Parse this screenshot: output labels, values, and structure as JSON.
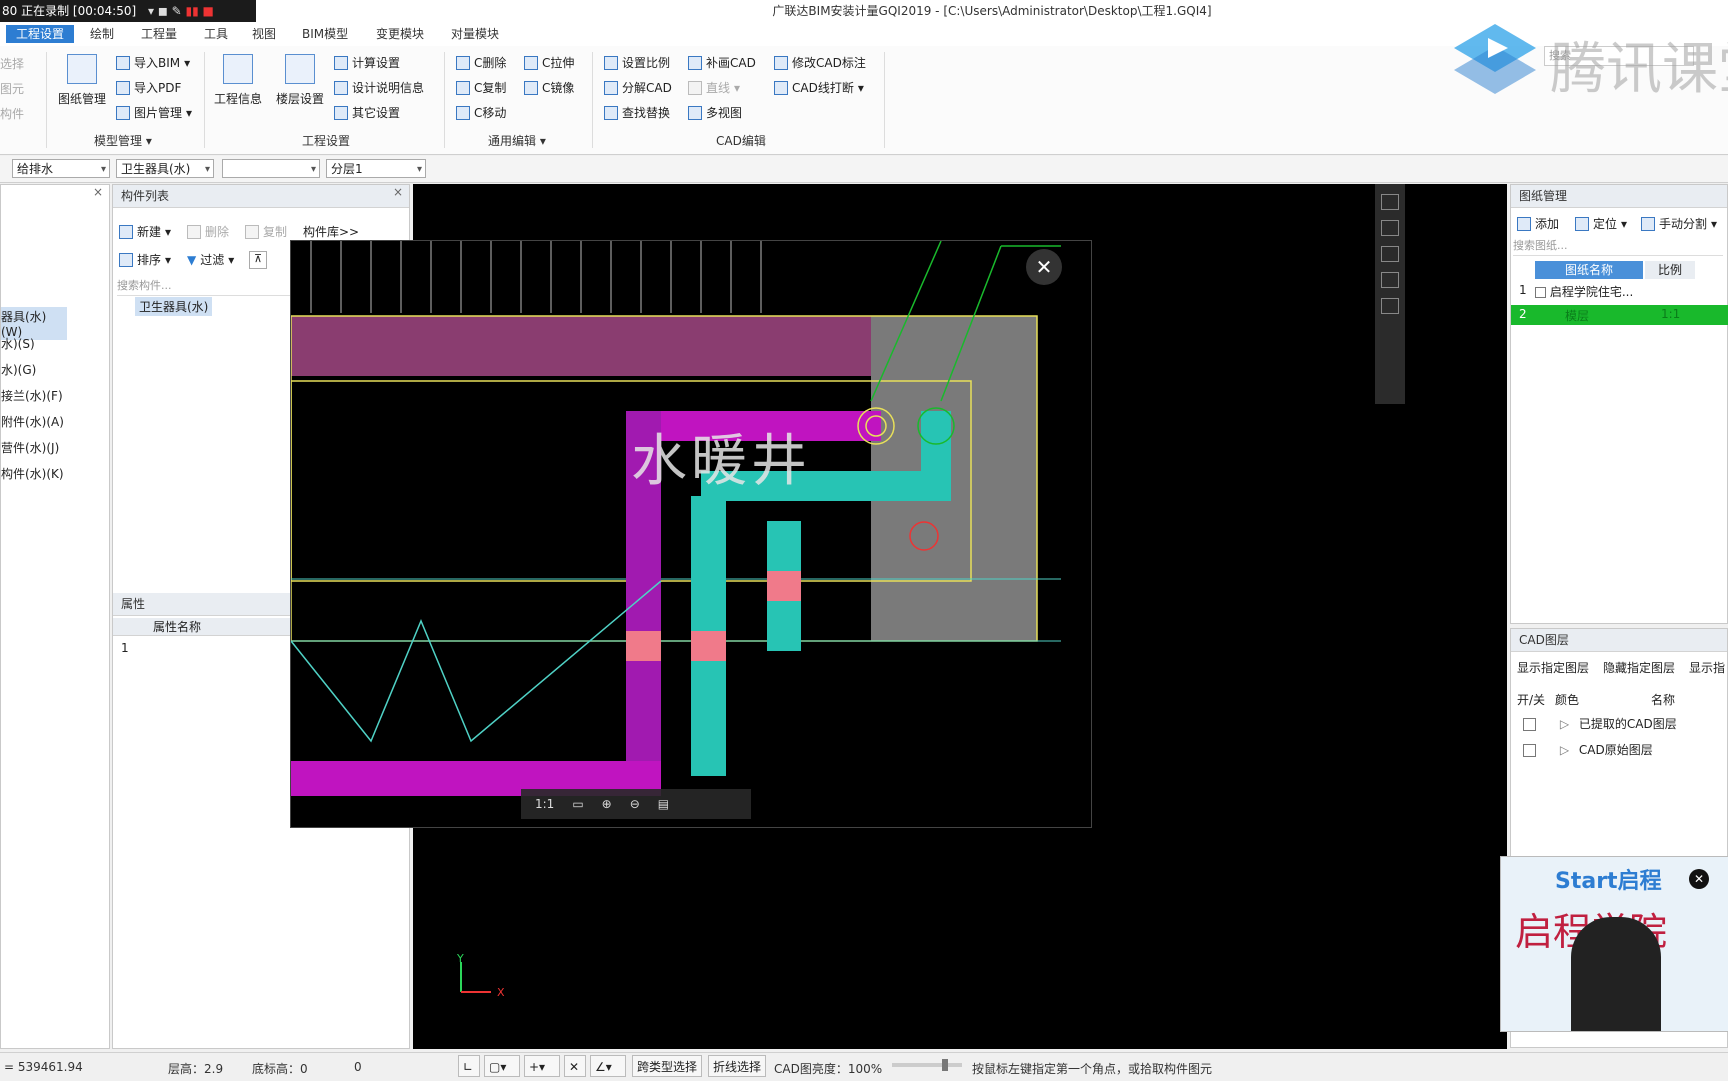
{
  "recording": {
    "text": "80 正在录制 [00:04:50]"
  },
  "window": {
    "title": "广联达BIM安装计量GQI2019 - [C:\\Users\\Administrator\\Desktop\\工程1.GQI4]"
  },
  "menus": [
    "工程设置",
    "绘制",
    "工程量",
    "工具",
    "视图",
    "BIM模型",
    "变更模块",
    "对量模块"
  ],
  "ribbon": {
    "left_stub": [
      "选择",
      "图元",
      "构件"
    ],
    "model": {
      "big": "图纸管理",
      "items": [
        "导入BIM",
        "导入PDF",
        "图片管理"
      ],
      "group": "模型管理"
    },
    "project": {
      "big1": "工程信息",
      "big2": "楼层设置",
      "items": [
        "计算设置",
        "设计说明信息",
        "其它设置"
      ],
      "group": "工程设置"
    },
    "edit": {
      "items": [
        "C删除",
        "C复制",
        "C移动",
        "C拉伸",
        "C镜像"
      ],
      "group": "通用编辑"
    },
    "cad": {
      "items": [
        "设置比例",
        "分解CAD",
        "查找替换",
        "补画CAD",
        "直线",
        "多视图",
        "修改CAD标注",
        "CAD线打断"
      ],
      "group": "CAD编辑"
    },
    "search_placeholder": "搜索"
  },
  "toolbar": {
    "combo1": "给排水",
    "combo2": "卫生器具(水)",
    "combo3": "",
    "combo4": "分层1"
  },
  "nav_panel": {
    "items": [
      "器具(水)(W)",
      "水)(S)",
      "水)(G)",
      "接兰(水)(F)",
      "附件(水)(A)",
      "营件(水)(J)",
      "构件(水)(K)"
    ]
  },
  "component_list": {
    "title": "构件列表",
    "actions": [
      "新建",
      "删除",
      "复制",
      "构件库>>"
    ],
    "sort": "排序",
    "filter": "过滤",
    "search_placeholder": "搜索构件...",
    "selected": "卫生器具(水)"
  },
  "properties": {
    "title": "属性",
    "col_header": "属性名称",
    "row1": "1"
  },
  "preview": {
    "zoom_label": "1:1",
    "drawing_text": "水暖井"
  },
  "drawing_panel": {
    "title": "图纸管理",
    "actions": [
      "添加",
      "定位",
      "手动分割"
    ],
    "search_placeholder": "搜索图纸...",
    "cols": [
      "图纸名称",
      "比例"
    ],
    "rows": [
      {
        "idx": "1",
        "name": "启程学院住宅...",
        "ratio": ""
      },
      {
        "idx": "2",
        "name": "模层",
        "ratio": "1:1"
      }
    ]
  },
  "cad_layers": {
    "title": "CAD图层",
    "actions": [
      "显示指定图层",
      "隐藏指定图层",
      "显示指"
    ],
    "cols": [
      "开/关",
      "颜色",
      "名称"
    ],
    "rows": [
      "已提取的CAD图层",
      "CAD原始图层"
    ]
  },
  "axis": {
    "x": "X",
    "y": "Y"
  },
  "status": {
    "coord": "= 539461.94",
    "floor_height": "层高：2.9",
    "base_height": "底标高：0",
    "zero": "0",
    "btn_cross": "跨类型选择",
    "btn_poly": "折线选择",
    "cad_brightness": "CAD图亮度：100%",
    "hint": "按鼠标左键指定第一个角点，或拾取构件图元"
  },
  "watermark": {
    "brand": "腾讯课堂",
    "school1": "Start启程",
    "school2": "启程学院"
  },
  "colors": {
    "accent": "#2d7dd2",
    "magenta": "#c014c0",
    "teal": "#27c4b4",
    "pink": "#f07a8a",
    "yellow": "#e8e05a",
    "green": "#19b92c"
  }
}
